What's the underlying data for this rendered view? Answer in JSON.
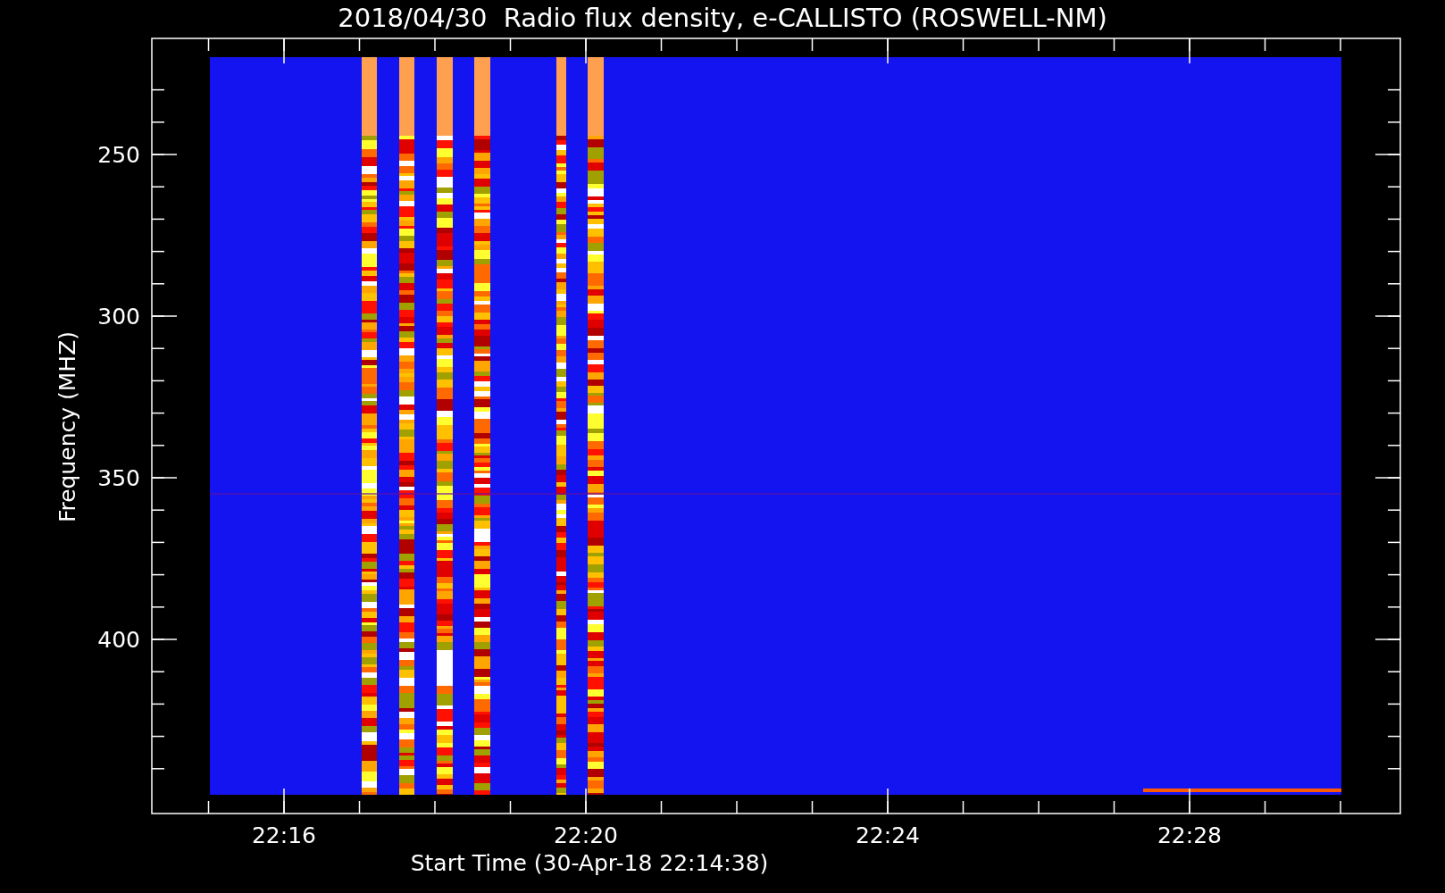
{
  "title": "2018/04/30  Radio flux density, e-CALLISTO (ROSWELL-NM)",
  "ylabel": "Frequency (MHZ)",
  "xlabel": "Start Time (30-Apr-18 22:14:38)",
  "yticks": [
    "250",
    "300",
    "350",
    "400"
  ],
  "xticks": [
    "22:16",
    "22:20",
    "22:24",
    "22:28"
  ]
}
